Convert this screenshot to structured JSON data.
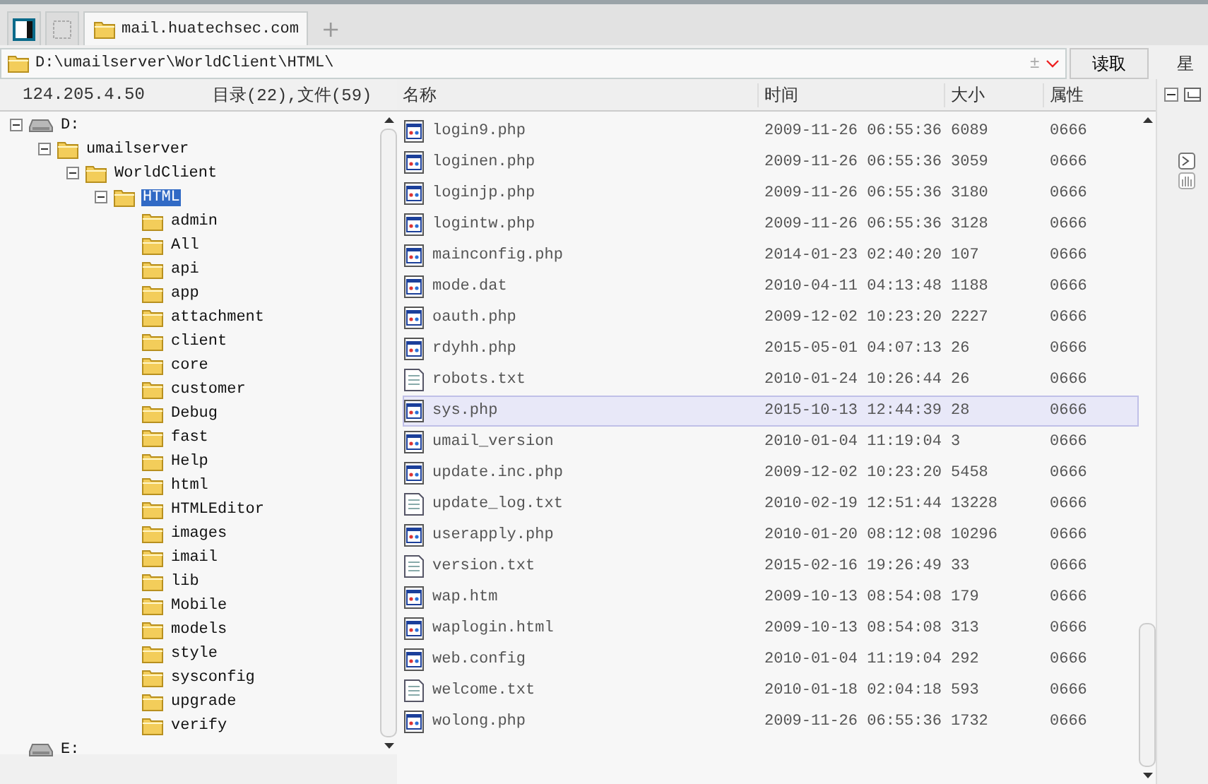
{
  "tabs": [
    {
      "kind": "panel",
      "selected": false
    },
    {
      "kind": "blank",
      "selected": false
    },
    {
      "kind": "folder",
      "label": "mail.huatechsec.com",
      "selected": true
    }
  ],
  "new_tab": "+",
  "address": {
    "value": "D:\\umailserver\\WorldClient\\HTML\\",
    "plus_minus": "±"
  },
  "read_button": "读取",
  "right_header": "星",
  "host": "124.205.4.50",
  "summary": "目录(22),文件(59)",
  "columns": [
    "名称",
    "时间",
    "大小",
    "属性"
  ],
  "tree": [
    {
      "kind": "drive",
      "label": "D:",
      "expanded": true,
      "selected": false,
      "children": [
        {
          "kind": "folder",
          "label": "umailserver",
          "expanded": true,
          "selected": false,
          "children": [
            {
              "kind": "folder",
              "label": "WorldClient",
              "expanded": true,
              "selected": false,
              "children": [
                {
                  "kind": "folder",
                  "label": "HTML",
                  "expanded": true,
                  "selected": true,
                  "children": [
                    {
                      "kind": "folder",
                      "label": "admin",
                      "selected": false
                    },
                    {
                      "kind": "folder",
                      "label": "All",
                      "selected": false
                    },
                    {
                      "kind": "folder",
                      "label": "api",
                      "selected": false
                    },
                    {
                      "kind": "folder",
                      "label": "app",
                      "selected": false
                    },
                    {
                      "kind": "folder",
                      "label": "attachment",
                      "selected": false
                    },
                    {
                      "kind": "folder",
                      "label": "client",
                      "selected": false
                    },
                    {
                      "kind": "folder",
                      "label": "core",
                      "selected": false
                    },
                    {
                      "kind": "folder",
                      "label": "customer",
                      "selected": false
                    },
                    {
                      "kind": "folder",
                      "label": "Debug",
                      "selected": false
                    },
                    {
                      "kind": "folder",
                      "label": "fast",
                      "selected": false
                    },
                    {
                      "kind": "folder",
                      "label": "Help",
                      "selected": false
                    },
                    {
                      "kind": "folder",
                      "label": "html",
                      "selected": false
                    },
                    {
                      "kind": "folder",
                      "label": "HTMLEditor",
                      "selected": false
                    },
                    {
                      "kind": "folder",
                      "label": "images",
                      "selected": false
                    },
                    {
                      "kind": "folder",
                      "label": "imail",
                      "selected": false
                    },
                    {
                      "kind": "folder",
                      "label": "lib",
                      "selected": false
                    },
                    {
                      "kind": "folder",
                      "label": "Mobile",
                      "selected": false
                    },
                    {
                      "kind": "folder",
                      "label": "models",
                      "selected": false
                    },
                    {
                      "kind": "folder",
                      "label": "style",
                      "selected": false
                    },
                    {
                      "kind": "folder",
                      "label": "sysconfig",
                      "selected": false
                    },
                    {
                      "kind": "folder",
                      "label": "upgrade",
                      "selected": false
                    },
                    {
                      "kind": "folder",
                      "label": "verify",
                      "selected": false
                    }
                  ]
                }
              ]
            }
          ]
        }
      ]
    },
    {
      "kind": "drive",
      "label": "E:",
      "selected": false
    }
  ],
  "files": [
    {
      "kind": "app",
      "name": "login9.php",
      "time": "2009-11-26 06:55:36",
      "size": "6089",
      "attr": "0666",
      "selected": false
    },
    {
      "kind": "app",
      "name": "loginen.php",
      "time": "2009-11-26 06:55:36",
      "size": "3059",
      "attr": "0666",
      "selected": false
    },
    {
      "kind": "app",
      "name": "loginjp.php",
      "time": "2009-11-26 06:55:36",
      "size": "3180",
      "attr": "0666",
      "selected": false
    },
    {
      "kind": "app",
      "name": "logintw.php",
      "time": "2009-11-26 06:55:36",
      "size": "3128",
      "attr": "0666",
      "selected": false
    },
    {
      "kind": "app",
      "name": "mainconfig.php",
      "time": "2014-01-23 02:40:20",
      "size": "107",
      "attr": "0666",
      "selected": false
    },
    {
      "kind": "app",
      "name": "mode.dat",
      "time": "2010-04-11 04:13:48",
      "size": "1188",
      "attr": "0666",
      "selected": false
    },
    {
      "kind": "app",
      "name": "oauth.php",
      "time": "2009-12-02 10:23:20",
      "size": "2227",
      "attr": "0666",
      "selected": false
    },
    {
      "kind": "app",
      "name": "rdyhh.php",
      "time": "2015-05-01 04:07:13",
      "size": "26",
      "attr": "0666",
      "selected": false
    },
    {
      "kind": "text",
      "name": "robots.txt",
      "time": "2010-01-24 10:26:44",
      "size": "26",
      "attr": "0666",
      "selected": false
    },
    {
      "kind": "app",
      "name": "sys.php",
      "time": "2015-10-13 12:44:39",
      "size": "28",
      "attr": "0666",
      "selected": true
    },
    {
      "kind": "app",
      "name": "umail_version",
      "time": "2010-01-04 11:19:04",
      "size": "3",
      "attr": "0666",
      "selected": false
    },
    {
      "kind": "app",
      "name": "update.inc.php",
      "time": "2009-12-02 10:23:20",
      "size": "5458",
      "attr": "0666",
      "selected": false
    },
    {
      "kind": "text",
      "name": "update_log.txt",
      "time": "2010-02-19 12:51:44",
      "size": "13228",
      "attr": "0666",
      "selected": false
    },
    {
      "kind": "app",
      "name": "userapply.php",
      "time": "2010-01-20 08:12:08",
      "size": "10296",
      "attr": "0666",
      "selected": false
    },
    {
      "kind": "text",
      "name": "version.txt",
      "time": "2015-02-16 19:26:49",
      "size": "33",
      "attr": "0666",
      "selected": false
    },
    {
      "kind": "app",
      "name": "wap.htm",
      "time": "2009-10-13 08:54:08",
      "size": "179",
      "attr": "0666",
      "selected": false
    },
    {
      "kind": "app",
      "name": "waplogin.html",
      "time": "2009-10-13 08:54:08",
      "size": "313",
      "attr": "0666",
      "selected": false
    },
    {
      "kind": "app",
      "name": "web.config",
      "time": "2010-01-04 11:19:04",
      "size": "292",
      "attr": "0666",
      "selected": false
    },
    {
      "kind": "text",
      "name": "welcome.txt",
      "time": "2010-01-18 02:04:18",
      "size": "593",
      "attr": "0666",
      "selected": false
    },
    {
      "kind": "app",
      "name": "wolong.php",
      "time": "2009-11-26 06:55:36",
      "size": "1732",
      "attr": "0666",
      "selected": false
    }
  ]
}
